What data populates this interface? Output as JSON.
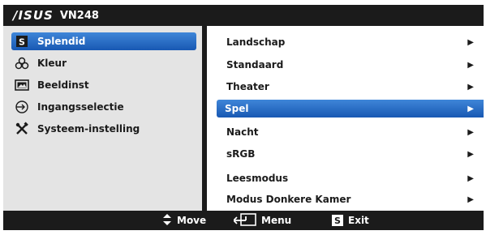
{
  "title": {
    "brand": "/ISUS",
    "model": "VN248"
  },
  "left_menu": [
    {
      "label": "Splendid",
      "icon": "splendid-s-icon",
      "selected": true
    },
    {
      "label": "Kleur",
      "icon": "color-circles-icon",
      "selected": false
    },
    {
      "label": "Beeldinst",
      "icon": "image-icon",
      "selected": false
    },
    {
      "label": "Ingangsselectie",
      "icon": "input-select-icon",
      "selected": false
    },
    {
      "label": "Systeem-instelling",
      "icon": "tools-icon",
      "selected": false
    }
  ],
  "right_menu": [
    {
      "label": "Landschap",
      "selected": false
    },
    {
      "label": "Standaard",
      "selected": false
    },
    {
      "label": "Theater",
      "selected": false
    },
    {
      "label": "Spel",
      "selected": true
    },
    {
      "label": "Nacht",
      "selected": false
    },
    {
      "label": "sRGB",
      "selected": false
    },
    {
      "label": "Leesmodus",
      "selected": false
    },
    {
      "label": "Modus Donkere Kamer",
      "selected": false
    }
  ],
  "footer": {
    "move_label": "Move",
    "menu_label": "Menu",
    "exit_label": "Exit",
    "exit_key": "S"
  },
  "colors": {
    "background": "#1b1b1b",
    "left_panel": "#e4e4e4",
    "right_panel": "#ffffff",
    "accent": "#2a6cc6"
  }
}
